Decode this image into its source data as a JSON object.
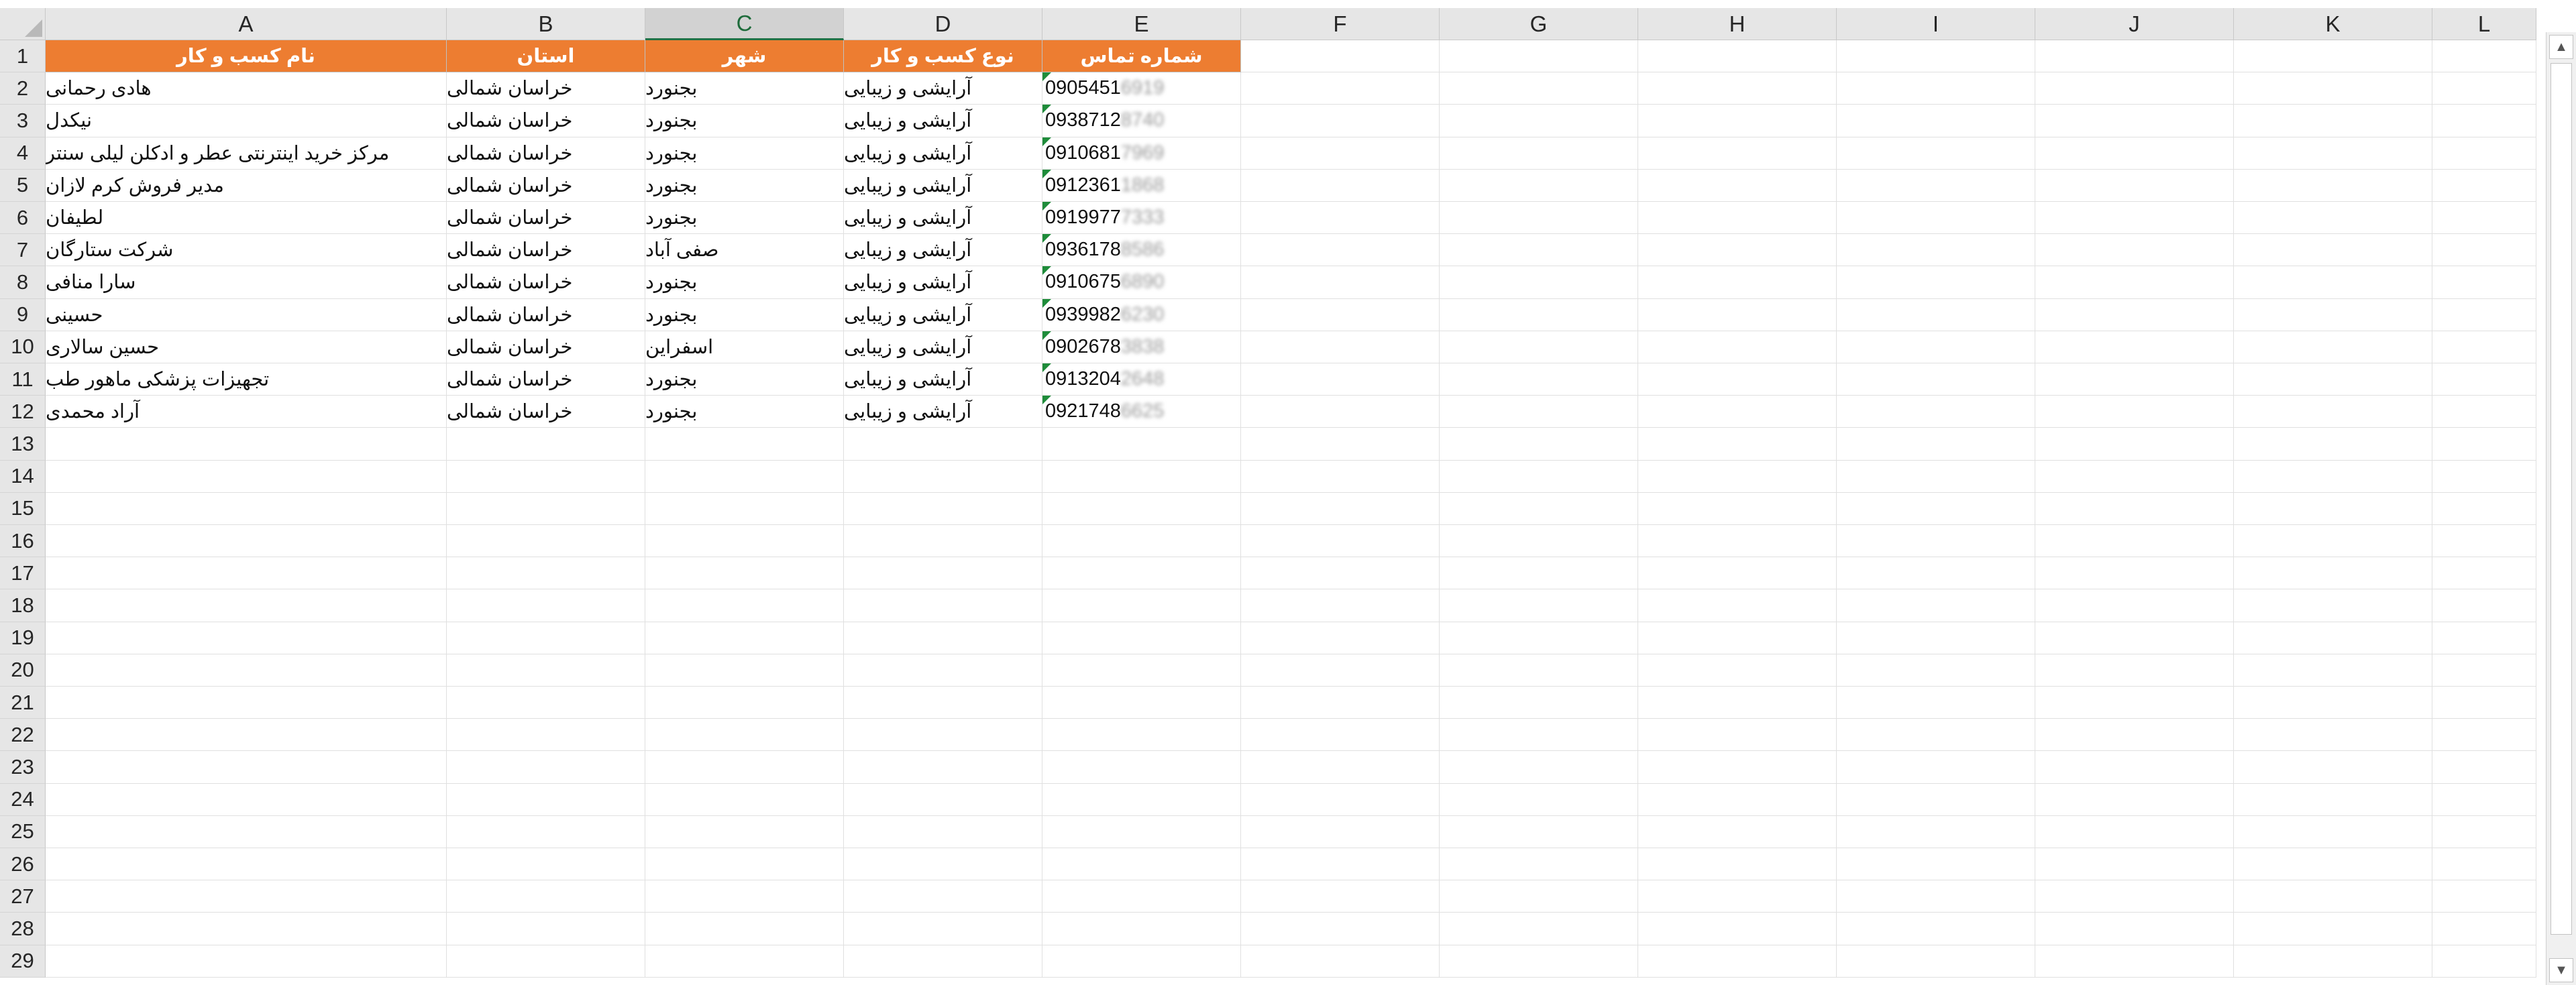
{
  "columns": [
    "A",
    "B",
    "C",
    "D",
    "E",
    "F",
    "G",
    "H",
    "I",
    "J",
    "K",
    "L"
  ],
  "selected_column": "C",
  "header_fill_color": "#ed7d31",
  "header_text_color": "#ffffff",
  "headers": [
    "نام کسب و کار",
    "استان",
    "شهر",
    "نوع کسب و کار",
    "شماره تماس"
  ],
  "rows": [
    {
      "name": "هادی رحمانی",
      "province": "خراسان شمالی",
      "city": "بجنورد",
      "type": "آرایشی و زیبایی",
      "phone_visible": "0905451",
      "phone_masked": "6919"
    },
    {
      "name": "نیکدل",
      "province": "خراسان شمالی",
      "city": "بجنورد",
      "type": "آرایشی و زیبایی",
      "phone_visible": "0938712",
      "phone_masked": "8740"
    },
    {
      "name": "مرکز خرید اینترنتی عطر و ادکلن لیلی سنتر",
      "province": "خراسان شمالی",
      "city": "بجنورد",
      "type": "آرایشی و زیبایی",
      "phone_visible": "0910681",
      "phone_masked": "7969"
    },
    {
      "name": "مدیر فروش کرم لازان",
      "province": "خراسان شمالی",
      "city": "بجنورد",
      "type": "آرایشی و زیبایی",
      "phone_visible": "0912361",
      "phone_masked": "1868"
    },
    {
      "name": "لطیفان",
      "province": "خراسان شمالی",
      "city": "بجنورد",
      "type": "آرایشی و زیبایی",
      "phone_visible": "0919977",
      "phone_masked": "7333"
    },
    {
      "name": "شرکت ستارگان",
      "province": "خراسان شمالی",
      "city": "صفی آباد",
      "type": "آرایشی و زیبایی",
      "phone_visible": "0936178",
      "phone_masked": "8586"
    },
    {
      "name": "سارا منافی",
      "province": "خراسان شمالی",
      "city": "بجنورد",
      "type": "آرایشی و زیبایی",
      "phone_visible": "0910675",
      "phone_masked": "6890"
    },
    {
      "name": "حسینی",
      "province": "خراسان شمالی",
      "city": "بجنورد",
      "type": "آرایشی و زیبایی",
      "phone_visible": "0939982",
      "phone_masked": "6230"
    },
    {
      "name": "حسین سالاری",
      "province": "خراسان شمالی",
      "city": "اسفراین",
      "type": "آرایشی و زیبایی",
      "phone_visible": "0902678",
      "phone_masked": "3838"
    },
    {
      "name": "تجهیزات پزشکی ماهور طب",
      "province": "خراسان شمالی",
      "city": "بجنورد",
      "type": "آرایشی و زیبایی",
      "phone_visible": "0913204",
      "phone_masked": "2648"
    },
    {
      "name": "آراد محمدی",
      "province": "خراسان شمالی",
      "city": "بجنورد",
      "type": "آرایشی و زیبایی",
      "phone_visible": "0921748",
      "phone_masked": "6625"
    }
  ],
  "row_numbers": [
    "1",
    "2",
    "3",
    "4",
    "5",
    "6",
    "7",
    "8",
    "9",
    "10",
    "11",
    "12",
    "13",
    "14",
    "15",
    "16",
    "17",
    "18",
    "19",
    "20",
    "21",
    "22",
    "23",
    "24",
    "25",
    "26",
    "27",
    "28",
    "29"
  ],
  "scroll": {
    "up_icon": "▲",
    "down_icon": "▼"
  }
}
